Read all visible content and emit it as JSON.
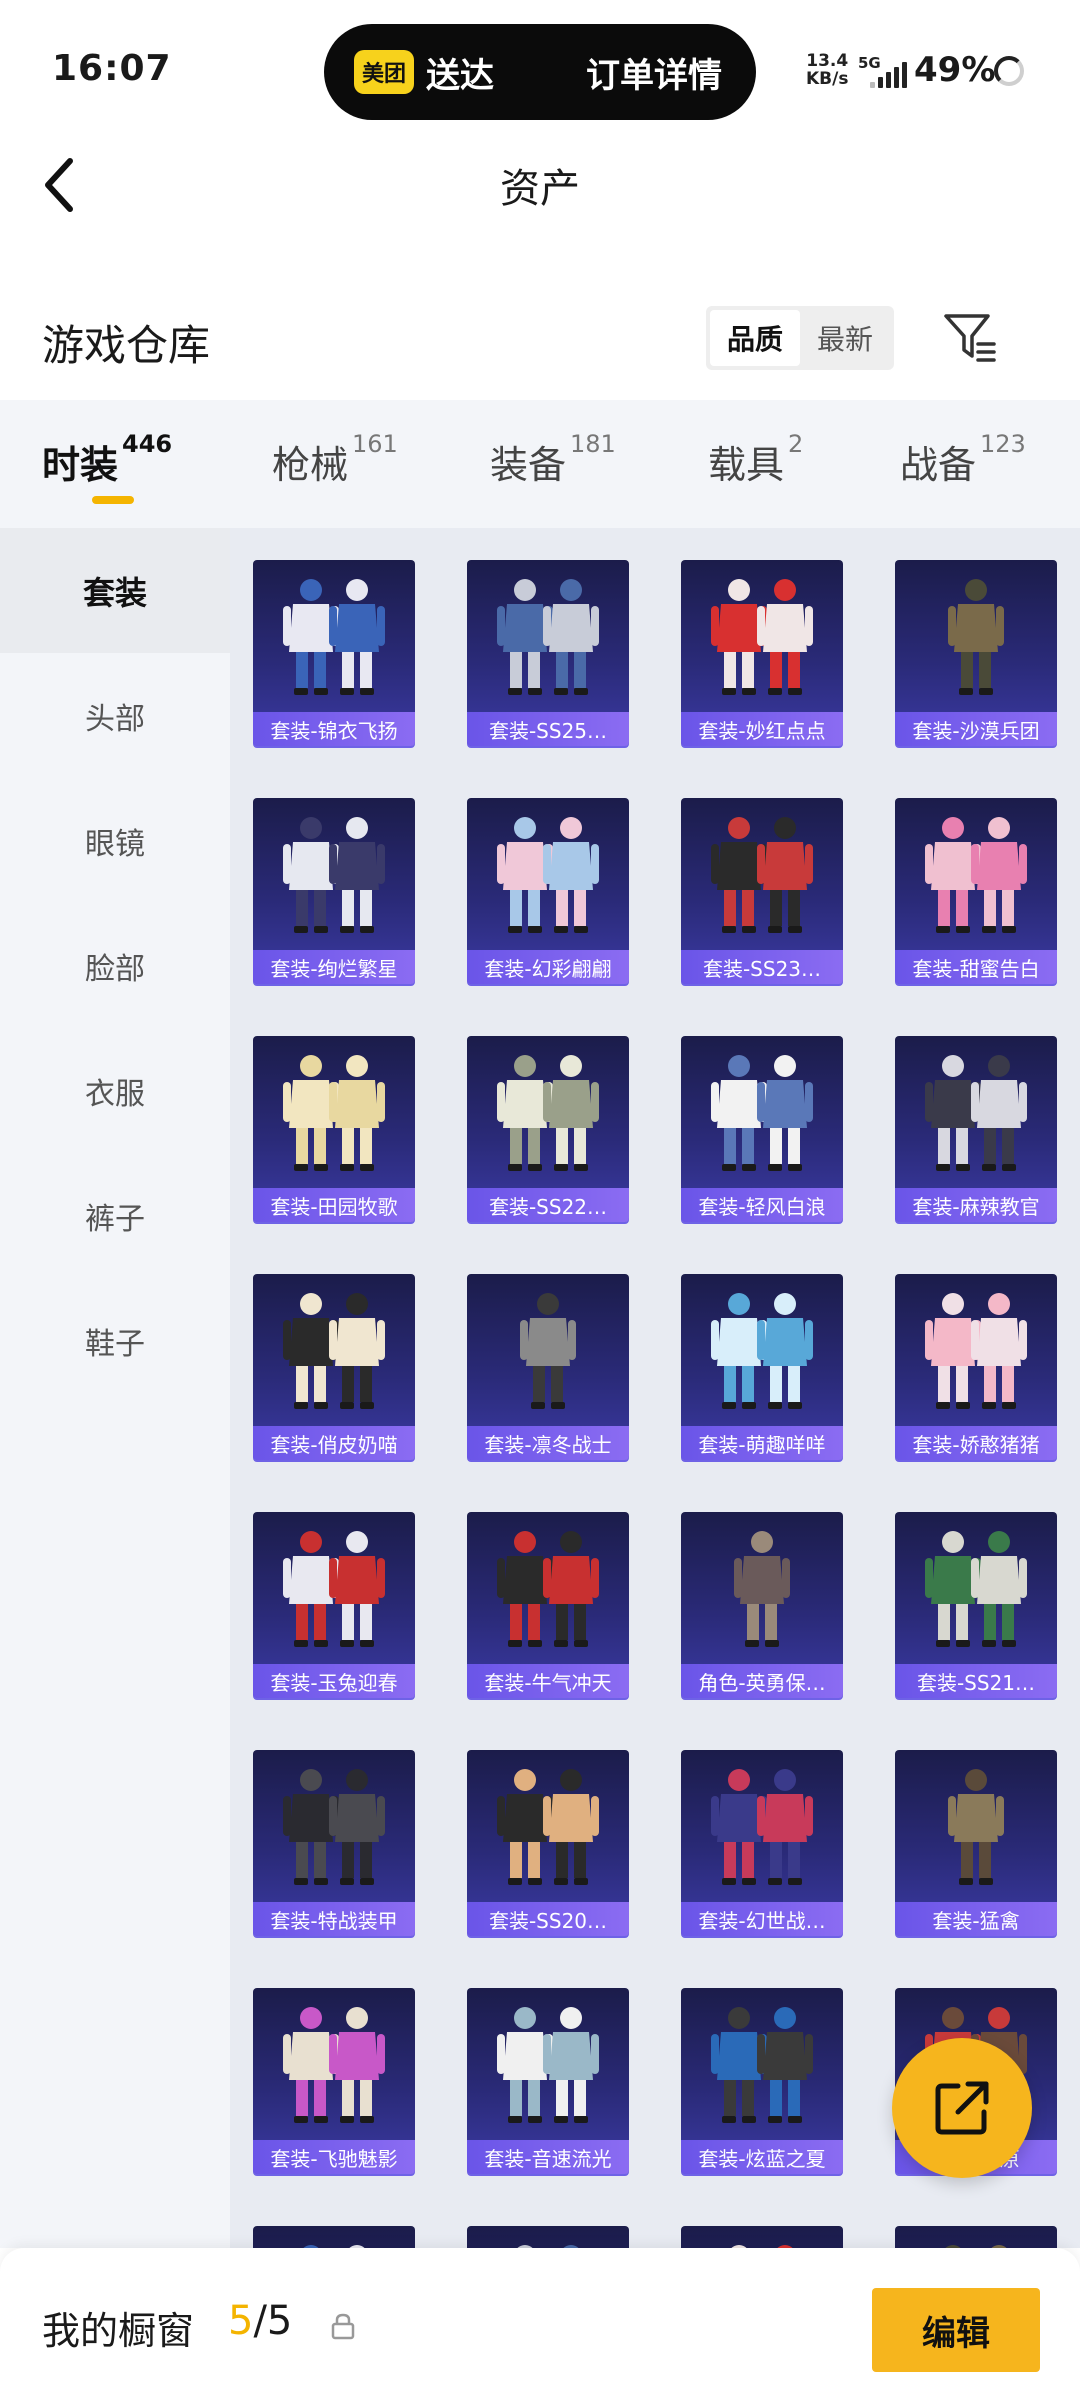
{
  "status_bar": {
    "time": "16:07",
    "island_badge": "美团",
    "island_left": "送达",
    "island_right": "订单详情",
    "net_speed_value": "13.4",
    "net_speed_unit": "KB/s",
    "network": "5G",
    "battery": "49%"
  },
  "header": {
    "title": "资产",
    "back_icon": "chevron-left-icon"
  },
  "warehouse": {
    "title": "游戏仓库",
    "sort_options": [
      "品质",
      "最新"
    ],
    "sort_selected": "品质",
    "filter_icon": "filter-icon"
  },
  "tabs": [
    {
      "label": "时装",
      "count": "446",
      "active": true
    },
    {
      "label": "枪械",
      "count": "161",
      "active": false
    },
    {
      "label": "装备",
      "count": "181",
      "active": false
    },
    {
      "label": "载具",
      "count": "2",
      "active": false
    },
    {
      "label": "战备",
      "count": "123",
      "active": false
    }
  ],
  "sidebar": {
    "items": [
      {
        "label": "套装",
        "active": true
      },
      {
        "label": "头部",
        "active": false
      },
      {
        "label": "眼镜",
        "active": false
      },
      {
        "label": "脸部",
        "active": false
      },
      {
        "label": "衣服",
        "active": false
      },
      {
        "label": "裤子",
        "active": false
      },
      {
        "label": "鞋子",
        "active": false
      }
    ]
  },
  "items": [
    {
      "name": "套装-锦衣飞扬"
    },
    {
      "name": "套装-SS25…"
    },
    {
      "name": "套装-妙红点点"
    },
    {
      "name": "套装-沙漠兵团"
    },
    {
      "name": "套装-绚烂繁星"
    },
    {
      "name": "套装-幻彩翩翩"
    },
    {
      "name": "套装-SS23…"
    },
    {
      "name": "套装-甜蜜告白"
    },
    {
      "name": "套装-田园牧歌"
    },
    {
      "name": "套装-SS22…"
    },
    {
      "name": "套装-轻风白浪"
    },
    {
      "name": "套装-麻辣教官"
    },
    {
      "name": "套装-俏皮奶喵"
    },
    {
      "name": "套装-凛冬战士"
    },
    {
      "name": "套装-萌趣咩咩"
    },
    {
      "name": "套装-娇憨猪猪"
    },
    {
      "name": "套装-玉兔迎春"
    },
    {
      "name": "套装-牛气冲天"
    },
    {
      "name": "角色-英勇保…"
    },
    {
      "name": "套装-SS21…"
    },
    {
      "name": "套装-特战装甲"
    },
    {
      "name": "套装-SS20…"
    },
    {
      "name": "套装-幻世战…"
    },
    {
      "name": "套装-猛禽"
    },
    {
      "name": "套装-飞驰魅影"
    },
    {
      "name": "套装-音速流光"
    },
    {
      "name": "套装-炫蓝之夏"
    },
    {
      "name": "套装-…原"
    }
  ],
  "fab": {
    "icon": "share-icon"
  },
  "bottom": {
    "showcase_label": "我的橱窗",
    "showcase_used": "5",
    "showcase_total": "/5",
    "lock_icon": "lock-icon",
    "edit_label": "编辑"
  },
  "colors": {
    "accent": "#f6b51d",
    "card_label": "#7a62ee",
    "card_bg": "#2a2a78",
    "panel_bg": "#f3f5f9"
  }
}
